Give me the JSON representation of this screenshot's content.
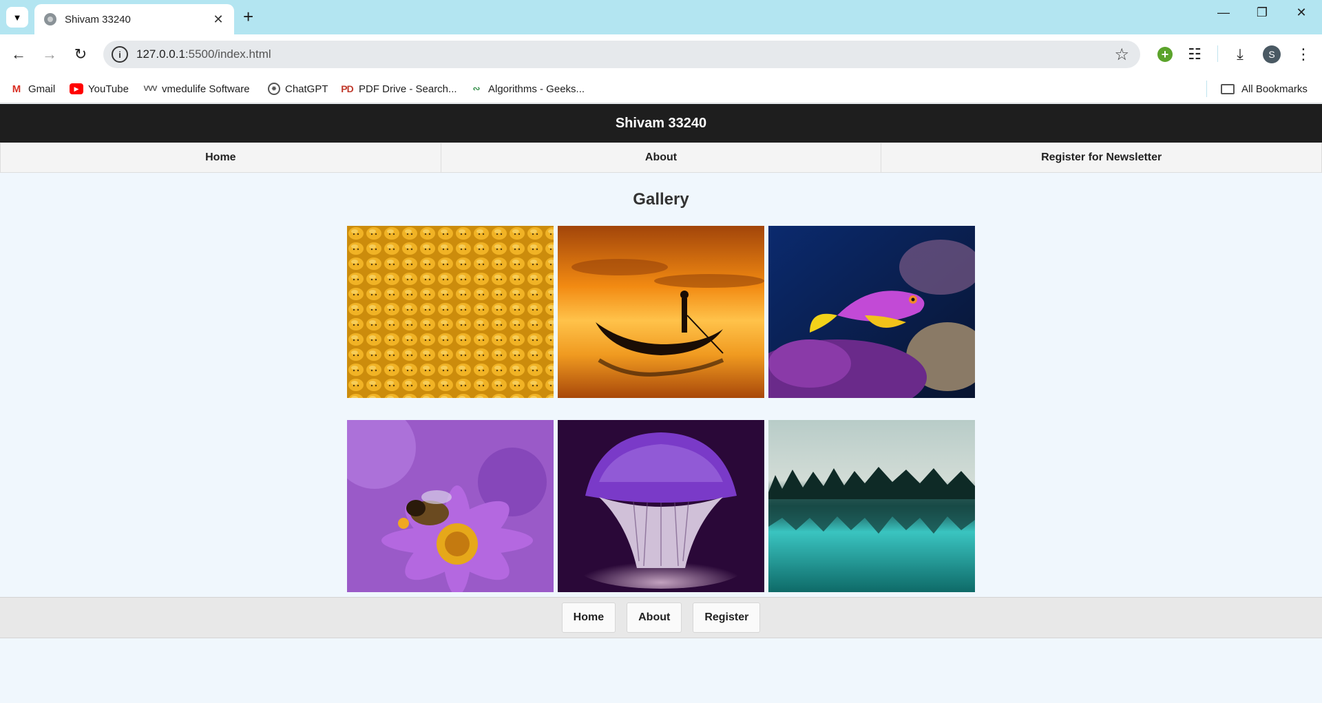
{
  "browser": {
    "tab_title": "Shivam 33240",
    "url_host": "127.0.0.1",
    "url_path": ":5500/index.html",
    "profile_initial": "S",
    "bookmarks": [
      {
        "label": "Gmail",
        "icon": "gmail-icon"
      },
      {
        "label": "YouTube",
        "icon": "youtube-icon"
      },
      {
        "label": "vmedulife Software",
        "icon": "vmedulife-icon"
      },
      {
        "label": "ChatGPT",
        "icon": "chatgpt-icon"
      },
      {
        "label": "PDF Drive - Search...",
        "icon": "pdfdrive-icon"
      },
      {
        "label": "Algorithms - Geeks...",
        "icon": "geeksforgeeks-icon"
      }
    ],
    "all_bookmarks": "All Bookmarks"
  },
  "site": {
    "header_title": "Shivam 33240",
    "nav": [
      "Home",
      "About",
      "Register for Newsletter"
    ],
    "gallery_title": "Gallery",
    "gallery_images": [
      {
        "subject": "yellow toy faces"
      },
      {
        "subject": "gondola at sunset"
      },
      {
        "subject": "purple fish on coral"
      },
      {
        "subject": "bee on purple flower"
      },
      {
        "subject": "glowing purple mushroom"
      },
      {
        "subject": "teal lake with forest"
      }
    ],
    "footer_links": [
      "Home",
      "About",
      "Register"
    ]
  },
  "colors": {
    "tabbar": "#b3e5f1",
    "header_bg": "#1e1e1e",
    "page_bg": "#f0f7fd"
  }
}
